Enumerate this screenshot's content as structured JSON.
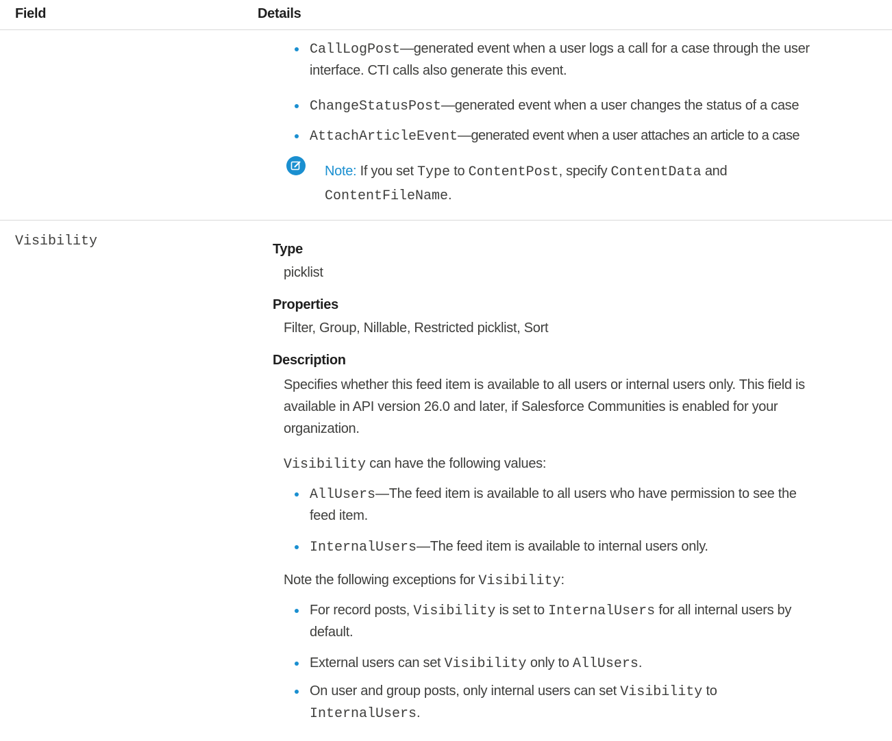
{
  "header": {
    "field": "Field",
    "details": "Details"
  },
  "type_list": [
    {
      "code": "CallLogPost",
      "text": "—generated event when a user logs a call for a case through the user",
      "text2": "interface. CTI calls also generate this event."
    },
    {
      "code": "ChangeStatusPost",
      "text": "—generated event when a user changes the status of a case"
    },
    {
      "code": "AttachArticleEvent",
      "text": "—generated event when a user attaches an article to a case"
    }
  ],
  "note": {
    "icon": "note-edit-icon",
    "label": "Note:",
    "t1": " If you set ",
    "c1": "Type",
    "t2": " to ",
    "c2": "ContentPost",
    "t3": ", specify ",
    "c3": "ContentData",
    "t4": " and",
    "c4": "ContentFileName",
    "t5": "."
  },
  "visibility": {
    "field_name": "Visibility",
    "type_heading": "Type",
    "type_value": "picklist",
    "properties_heading": "Properties",
    "properties_value": "Filter, Group, Nillable, Restricted picklist, Sort",
    "description_heading": "Description",
    "description_lines": [
      "Specifies whether this feed item is available to all users or internal users only. This field is",
      "available in API version 26.0 and later, if Salesforce Communities is enabled for your",
      "organization."
    ],
    "values_intro_code": "Visibility",
    "values_intro_text": " can have the following values:",
    "values": [
      {
        "code": "AllUsers",
        "text": "—The feed item is available to all users who have permission to see the",
        "text2": "feed item."
      },
      {
        "code": "InternalUsers",
        "text": "—The feed item is available to internal users only."
      }
    ],
    "exceptions_intro_text": "Note the following exceptions for ",
    "exceptions_intro_code": "Visibility",
    "exceptions_intro_end": ":",
    "exceptions": [
      {
        "t1": "For record posts, ",
        "c1": "Visibility",
        "t2": " is set to ",
        "c2": "InternalUsers",
        "t3": " for all internal users by",
        "line2": "default."
      },
      {
        "t1": "External users can set ",
        "c1": "Visibility",
        "t2": " only to ",
        "c2": "AllUsers",
        "t3": "."
      },
      {
        "t1": "On user and group posts, only internal users can set ",
        "c1": "Visibility",
        "t2": " to",
        "c2": "InternalUsers",
        "t3": "."
      }
    ]
  },
  "colors": {
    "accent": "#1a8fd0",
    "text": "#3e3e3c",
    "heading": "#1f1f1f",
    "divider": "#d8d8d8"
  }
}
